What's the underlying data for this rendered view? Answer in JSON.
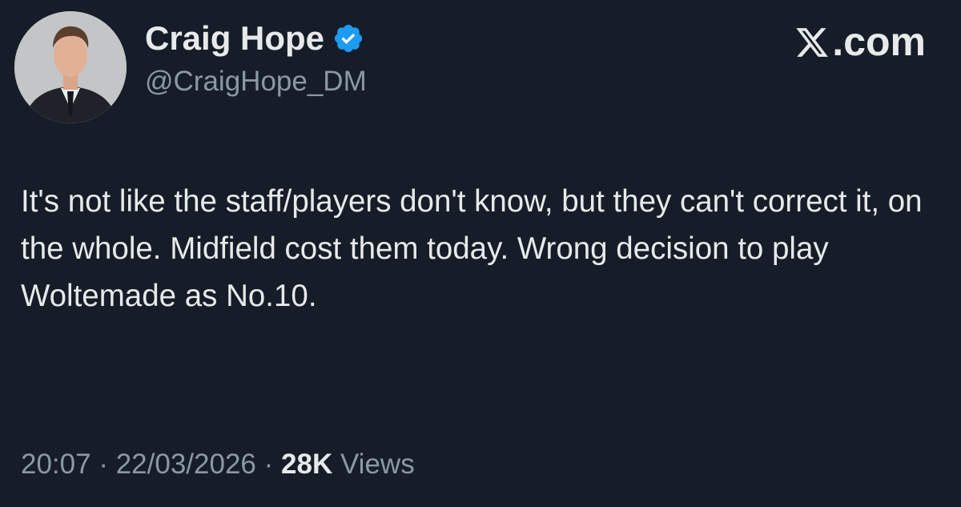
{
  "author": {
    "display_name": "Craig Hope",
    "handle": "@CraigHope_DM",
    "verified_icon": "verified-badge-icon",
    "avatar_icon": "avatar"
  },
  "brand": {
    "label": ".com",
    "icon": "x-logo-icon"
  },
  "tweet": {
    "text": "It's not like the staff/players don't know, but they can't correct it, on the whole. Midfield cost them today. Wrong decision to play Woltemade as No.10."
  },
  "meta": {
    "time": "20:07",
    "separator": "·",
    "date": "22/03/2026",
    "views_count": "28K",
    "views_label": "Views"
  },
  "colors": {
    "background": "#161d28",
    "text": "#e7e9ea",
    "muted": "#8b98a5",
    "verified": "#1d9bf0"
  }
}
